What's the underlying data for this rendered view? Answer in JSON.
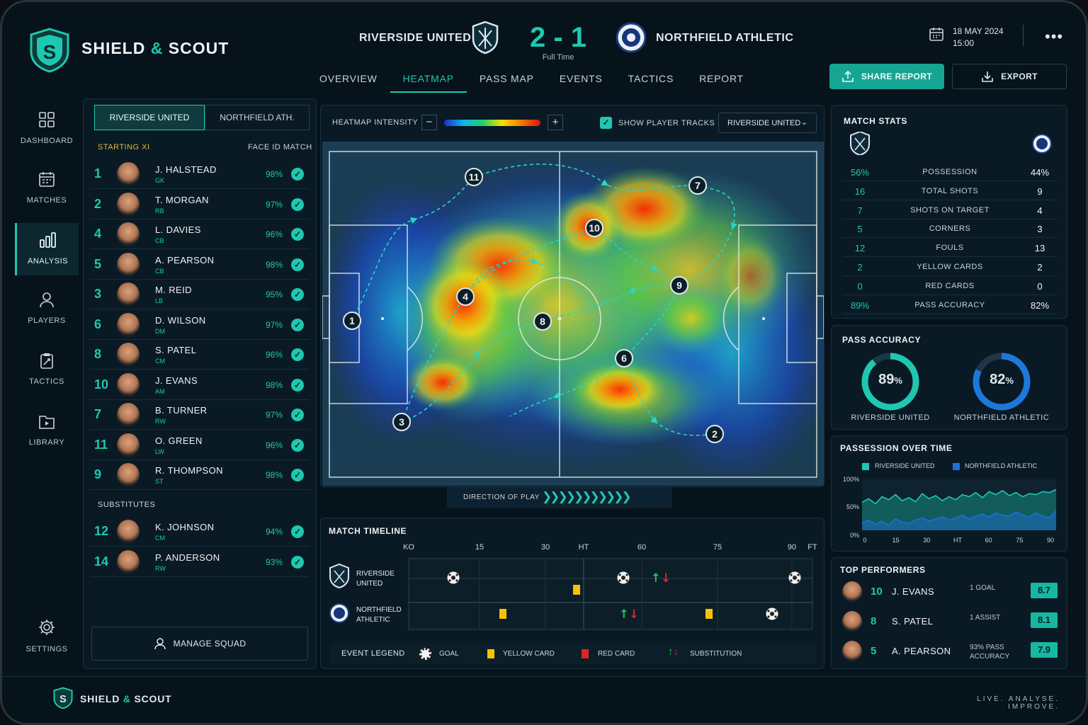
{
  "brand": {
    "name_left": "SHIELD",
    "amp": "&",
    "name_right": "SCOUT",
    "tagline": "LIVE.  ANALYSE.  IMPROVE."
  },
  "match": {
    "home": "RIVERSIDE UNITED",
    "away": "NORTHFIELD ATHLETIC",
    "score": "2 - 1",
    "status": "Full Time",
    "date": "18 MAY 2024",
    "time": "15:00"
  },
  "tabs": [
    {
      "label": "OVERVIEW",
      "active": false
    },
    {
      "label": "HEATMAP",
      "active": true
    },
    {
      "label": "PASS MAP",
      "active": false
    },
    {
      "label": "EVENTS",
      "active": false
    },
    {
      "label": "TACTICS",
      "active": false
    },
    {
      "label": "REPORT",
      "active": false
    }
  ],
  "actions": {
    "share": "SHARE REPORT",
    "export": "EXPORT"
  },
  "sidebar": [
    {
      "label": "DASHBOARD",
      "icon": "grid-icon"
    },
    {
      "label": "MATCHES",
      "icon": "calendar-icon"
    },
    {
      "label": "ANALYSIS",
      "icon": "bar-chart-icon",
      "active": true
    },
    {
      "label": "PLAYERS",
      "icon": "user-icon"
    },
    {
      "label": "TACTICS",
      "icon": "clipboard-icon"
    },
    {
      "label": "LIBRARY",
      "icon": "folder-play-icon"
    },
    {
      "label": "SETTINGS",
      "icon": "gear-icon"
    }
  ],
  "squad": {
    "team_tabs": [
      "RIVERSIDE UNITED",
      "NORTHFIELD ATH."
    ],
    "starting_label": "STARTING XI",
    "face_label": "FACE ID MATCH",
    "starting": [
      {
        "num": "1",
        "name": "J. HALSTEAD",
        "pos": "GK",
        "pct": "98%"
      },
      {
        "num": "2",
        "name": "T. MORGAN",
        "pos": "RB",
        "pct": "97%"
      },
      {
        "num": "4",
        "name": "L. DAVIES",
        "pos": "CB",
        "pct": "96%"
      },
      {
        "num": "5",
        "name": "A. PEARSON",
        "pos": "CB",
        "pct": "98%"
      },
      {
        "num": "3",
        "name": "M. REID",
        "pos": "LB",
        "pct": "95%"
      },
      {
        "num": "6",
        "name": "D. WILSON",
        "pos": "DM",
        "pct": "97%"
      },
      {
        "num": "8",
        "name": "S. PATEL",
        "pos": "CM",
        "pct": "96%"
      },
      {
        "num": "10",
        "name": "J. EVANS",
        "pos": "AM",
        "pct": "98%"
      },
      {
        "num": "7",
        "name": "B. TURNER",
        "pos": "RW",
        "pct": "97%"
      },
      {
        "num": "11",
        "name": "O. GREEN",
        "pos": "LW",
        "pct": "96%"
      },
      {
        "num": "9",
        "name": "R. THOMPSON",
        "pos": "ST",
        "pct": "98%"
      }
    ],
    "subs_label": "SUBSTITUTES",
    "subs": [
      {
        "num": "12",
        "name": "K. JOHNSON",
        "pos": "CM",
        "pct": "94%"
      },
      {
        "num": "14",
        "name": "P. ANDERSON",
        "pos": "RW",
        "pct": "93%"
      }
    ],
    "manage": "MANAGE SQUAD"
  },
  "heatmap": {
    "intensity_label": "HEATMAP INTENSITY",
    "minus": "−",
    "plus": "+",
    "tracks_label": "SHOW PLAYER TRACKS",
    "tracks_on": true,
    "team_select": "RIVERSIDE UNITED",
    "direction": "DIRECTION OF PLAY",
    "markers": [
      "1",
      "2",
      "3",
      "4",
      "6",
      "7",
      "8",
      "9",
      "10",
      "11"
    ]
  },
  "timeline": {
    "title": "MATCH TIMELINE",
    "ticks": [
      "KO",
      "15",
      "30",
      "HT",
      "60",
      "75",
      "90",
      "FT"
    ],
    "teams": [
      {
        "line1": "RIVERSIDE",
        "line2": "UNITED"
      },
      {
        "line1": "NORTHFIELD",
        "line2": "ATHLETIC"
      }
    ],
    "legend_title": "EVENT LEGEND",
    "legend": [
      "GOAL",
      "YELLOW CARD",
      "RED CARD",
      "SUBSTITUTION"
    ]
  },
  "stats": {
    "title": "MATCH STATS",
    "rows": [
      {
        "home": "56%",
        "label": "POSSESSION",
        "away": "44%"
      },
      {
        "home": "16",
        "label": "TOTAL SHOTS",
        "away": "9"
      },
      {
        "home": "7",
        "label": "SHOTS ON TARGET",
        "away": "4"
      },
      {
        "home": "5",
        "label": "CORNERS",
        "away": "3"
      },
      {
        "home": "12",
        "label": "FOULS",
        "away": "13"
      },
      {
        "home": "2",
        "label": "YELLOW CARDS",
        "away": "2"
      },
      {
        "home": "0",
        "label": "RED CARDS",
        "away": "0"
      },
      {
        "home": "89%",
        "label": "PASS ACCURACY",
        "away": "82%"
      }
    ]
  },
  "pass_accuracy": {
    "title": "PASS ACCURACY",
    "home": {
      "value": "89",
      "unit": "%",
      "fraction": 0.89,
      "label": "RIVERSIDE UNITED",
      "color": "#1ec8b0"
    },
    "away": {
      "value": "82",
      "unit": "%",
      "fraction": 0.82,
      "label": "NORTHFIELD ATHLETIC",
      "color": "#1e78d8"
    }
  },
  "possession_chart": {
    "title": "PASSESSION OVER TIME",
    "legend": [
      "RIVERSIDE UNITED",
      "NORTHFIELD ATHLETIC"
    ],
    "y_ticks": [
      "100%",
      "50%",
      "0%"
    ],
    "x_ticks": [
      "0",
      "15",
      "30",
      "HT",
      "60",
      "75",
      "90"
    ]
  },
  "chart_data": {
    "type": "area",
    "title": "PASSESSION OVER TIME",
    "x_ticks": [
      "0",
      "15",
      "30",
      "HT",
      "60",
      "75",
      "90"
    ],
    "ylim": [
      0,
      100
    ],
    "series": [
      {
        "name": "RIVERSIDE UNITED",
        "color": "#1ec8b0",
        "values": [
          55,
          62,
          52,
          66,
          60,
          70,
          58,
          64,
          56,
          72,
          62,
          68,
          58,
          66,
          60,
          70,
          66,
          74,
          64,
          76,
          70,
          78,
          68,
          74,
          66,
          72,
          70,
          76,
          74,
          80
        ]
      },
      {
        "name": "NORTHFIELD ATHLETIC",
        "color": "#1e6fd8",
        "values": [
          14,
          20,
          12,
          18,
          10,
          22,
          16,
          14,
          20,
          24,
          18,
          22,
          26,
          20,
          24,
          30,
          22,
          28,
          32,
          26,
          34,
          30,
          28,
          36,
          30,
          26,
          34,
          28,
          24,
          38
        ]
      }
    ]
  },
  "top_performers": {
    "title": "TOP PERFORMERS",
    "rows": [
      {
        "num": "10",
        "name": "J. EVANS",
        "desc": "1 GOAL",
        "rating": "8.7"
      },
      {
        "num": "8",
        "name": "S. PATEL",
        "desc": "1 ASSIST",
        "rating": "8.1"
      },
      {
        "num": "5",
        "name": "A. PEARSON",
        "desc": "93% PASS ACCURACY",
        "rating": "7.9"
      }
    ]
  },
  "colors": {
    "accent": "#1ec8b0",
    "away": "#1e6fd8",
    "yellow": "#f5c400",
    "red": "#e02424"
  }
}
